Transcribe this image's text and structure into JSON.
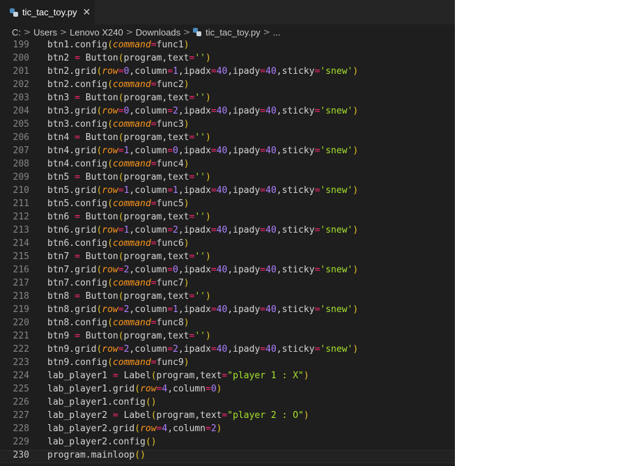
{
  "tab": {
    "label": "tic_tac_toy.py",
    "close_glyph": "✕",
    "icon": "python-file-icon"
  },
  "breadcrumb": {
    "items": [
      "C:",
      "Users",
      "Lenovo X240",
      "Downloads",
      "tic_tac_toy.py",
      "..."
    ],
    "separator": ">"
  },
  "editor": {
    "current_line": 230,
    "lines": [
      {
        "n": 199,
        "code": "btn1.config(command=func1)"
      },
      {
        "n": 200,
        "code": "btn2 = Button(program,text='')"
      },
      {
        "n": 201,
        "code": "btn2.grid(row=0,column=1,ipadx=40,ipady=40,sticky='snew')"
      },
      {
        "n": 202,
        "code": "btn2.config(command=func2)"
      },
      {
        "n": 203,
        "code": "btn3 = Button(program,text='')"
      },
      {
        "n": 204,
        "code": "btn3.grid(row=0,column=2,ipadx=40,ipady=40,sticky='snew')"
      },
      {
        "n": 205,
        "code": "btn3.config(command=func3)"
      },
      {
        "n": 206,
        "code": "btn4 = Button(program,text='')"
      },
      {
        "n": 207,
        "code": "btn4.grid(row=1,column=0,ipadx=40,ipady=40,sticky='snew')"
      },
      {
        "n": 208,
        "code": "btn4.config(command=func4)"
      },
      {
        "n": 209,
        "code": "btn5 = Button(program,text='')"
      },
      {
        "n": 210,
        "code": "btn5.grid(row=1,column=1,ipadx=40,ipady=40,sticky='snew')"
      },
      {
        "n": 211,
        "code": "btn5.config(command=func5)"
      },
      {
        "n": 212,
        "code": "btn6 = Button(program,text='')"
      },
      {
        "n": 213,
        "code": "btn6.grid(row=1,column=2,ipadx=40,ipady=40,sticky='snew')"
      },
      {
        "n": 214,
        "code": "btn6.config(command=func6)"
      },
      {
        "n": 215,
        "code": "btn7 = Button(program,text='')"
      },
      {
        "n": 216,
        "code": "btn7.grid(row=2,column=0,ipadx=40,ipady=40,sticky='snew')"
      },
      {
        "n": 217,
        "code": "btn7.config(command=func7)"
      },
      {
        "n": 218,
        "code": "btn8 = Button(program,text='')"
      },
      {
        "n": 219,
        "code": "btn8.grid(row=2,column=1,ipadx=40,ipady=40,sticky='snew')"
      },
      {
        "n": 220,
        "code": "btn8.config(command=func8)"
      },
      {
        "n": 221,
        "code": "btn9 = Button(program,text='')"
      },
      {
        "n": 222,
        "code": "btn9.grid(row=2,column=2,ipadx=40,ipady=40,sticky='snew')"
      },
      {
        "n": 223,
        "code": "btn9.config(command=func9)"
      },
      {
        "n": 224,
        "code": "lab_player1 = Label(program,text=\"player 1 : X\")"
      },
      {
        "n": 225,
        "code": "lab_player1.grid(row=4,column=0)"
      },
      {
        "n": 226,
        "code": "lab_player1.config()"
      },
      {
        "n": 227,
        "code": "lab_player2 = Label(program,text=\"player 2 : O\")"
      },
      {
        "n": 228,
        "code": "lab_player2.grid(row=4,column=2)"
      },
      {
        "n": 229,
        "code": "lab_player2.config()"
      },
      {
        "n": 230,
        "code": "program.mainloop()"
      }
    ]
  },
  "colors": {
    "editor_bg": "#1e1e1e",
    "tabbar_bg": "#252526",
    "text": "#d4d4d4",
    "keyword_arg": "#fd971f",
    "number": "#ae81ff",
    "string": "#a6e22e",
    "operator": "#f92672",
    "bracket": "#e6c229",
    "line_number": "#858585"
  }
}
